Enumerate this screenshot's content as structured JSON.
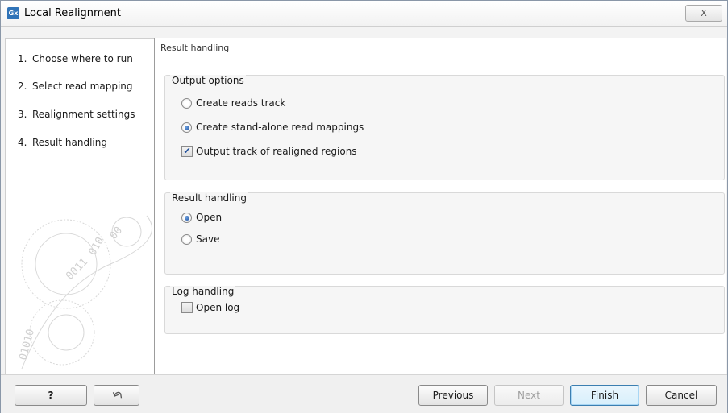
{
  "window": {
    "title": "Local Realignment",
    "app_icon": "Gx",
    "close_glyph": "X"
  },
  "steps": [
    {
      "num": "1.",
      "label": "Choose where to run"
    },
    {
      "num": "2.",
      "label": "Select read mapping"
    },
    {
      "num": "3.",
      "label": "Realignment settings"
    },
    {
      "num": "4.",
      "label": "Result handling"
    }
  ],
  "content": {
    "heading": "Result handling",
    "output_options": {
      "title": "Output options",
      "create_reads_track": {
        "label": "Create reads track",
        "selected": false
      },
      "create_standalone": {
        "label": "Create stand-alone read mappings",
        "selected": true
      },
      "output_track": {
        "label": "Output track of realigned regions",
        "checked": true
      }
    },
    "result_handling": {
      "title": "Result handling",
      "open": {
        "label": "Open",
        "selected": true
      },
      "save": {
        "label": "Save",
        "selected": false
      }
    },
    "log_handling": {
      "title": "Log handling",
      "open_log": {
        "label": "Open log",
        "checked": false
      }
    }
  },
  "buttons": {
    "help": "?",
    "reset_icon": "undo-icon",
    "previous": "Previous",
    "next": "Next",
    "finish": "Finish",
    "cancel": "Cancel"
  },
  "colors": {
    "accent": "#2f73b8",
    "radio_dot": "#1f4e9a"
  }
}
